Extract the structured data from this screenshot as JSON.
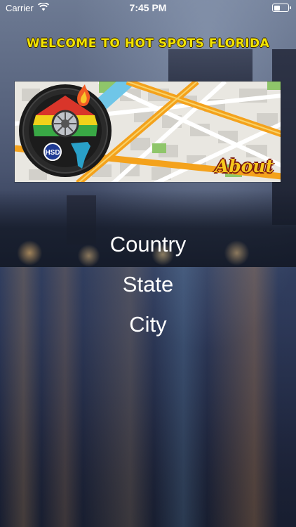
{
  "status_bar": {
    "carrier": "Carrier",
    "time": "7:45 PM",
    "icons": [
      "wifi-icon",
      "battery-icon"
    ]
  },
  "header": {
    "title": "WELCOME TO HOT SPOTS FLORIDA"
  },
  "banner": {
    "logo_text": "HSD",
    "about_label": "About"
  },
  "menu": {
    "items": [
      {
        "label": "Country"
      },
      {
        "label": "State"
      },
      {
        "label": "City"
      }
    ]
  },
  "colors": {
    "title": "#f3e400",
    "about": "#f6c81d",
    "text": "#ffffff"
  }
}
